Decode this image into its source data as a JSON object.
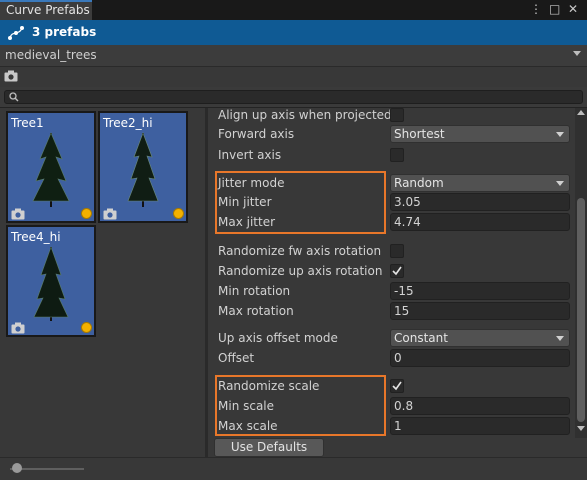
{
  "window": {
    "tab_title": "Curve Prefabs",
    "menu_glyph": "⋮",
    "maximize_glyph": "□",
    "close_glyph": "✕"
  },
  "header": {
    "icon": "curve-prefab-icon",
    "label": "3 prefabs"
  },
  "library": {
    "name": "medieval_trees"
  },
  "toolbar": {
    "icons": [
      "camera-icon"
    ]
  },
  "search": {
    "placeholder": "",
    "value": ""
  },
  "prefabs": [
    {
      "name": "Tree1",
      "status_color": "#f3b100"
    },
    {
      "name": "Tree2_hi",
      "status_color": "#f3b100"
    },
    {
      "name": "Tree4_hi",
      "status_color": "#f3b100"
    }
  ],
  "settings": {
    "align_up_axis": {
      "label": "Align up axis when projected",
      "checked": false
    },
    "forward_axis": {
      "label": "Forward axis",
      "value": "Shortest"
    },
    "invert_axis": {
      "label": "Invert axis",
      "checked": false
    },
    "jitter_mode": {
      "label": "Jitter mode",
      "value": "Random"
    },
    "min_jitter": {
      "label": "Min jitter",
      "value": "3.05"
    },
    "max_jitter": {
      "label": "Max jitter",
      "value": "4.74"
    },
    "randomize_fw": {
      "label": "Randomize fw axis rotation",
      "checked": false
    },
    "randomize_up": {
      "label": "Randomize up axis rotation",
      "checked": true
    },
    "min_rotation": {
      "label": "Min rotation",
      "value": "-15"
    },
    "max_rotation": {
      "label": "Max rotation",
      "value": "15"
    },
    "up_offset_mode": {
      "label": "Up axis offset mode",
      "value": "Constant"
    },
    "offset": {
      "label": "Offset",
      "value": "0"
    },
    "randomize_scale": {
      "label": "Randomize scale",
      "checked": true
    },
    "min_scale": {
      "label": "Min scale",
      "value": "0.8"
    },
    "max_scale": {
      "label": "Max scale",
      "value": "1"
    },
    "use_defaults": "Use Defaults"
  },
  "colors": {
    "accent": "#0f5a94",
    "highlight": "#e8772a",
    "thumb_bg": "#3e60a0",
    "status": "#f3b100"
  }
}
